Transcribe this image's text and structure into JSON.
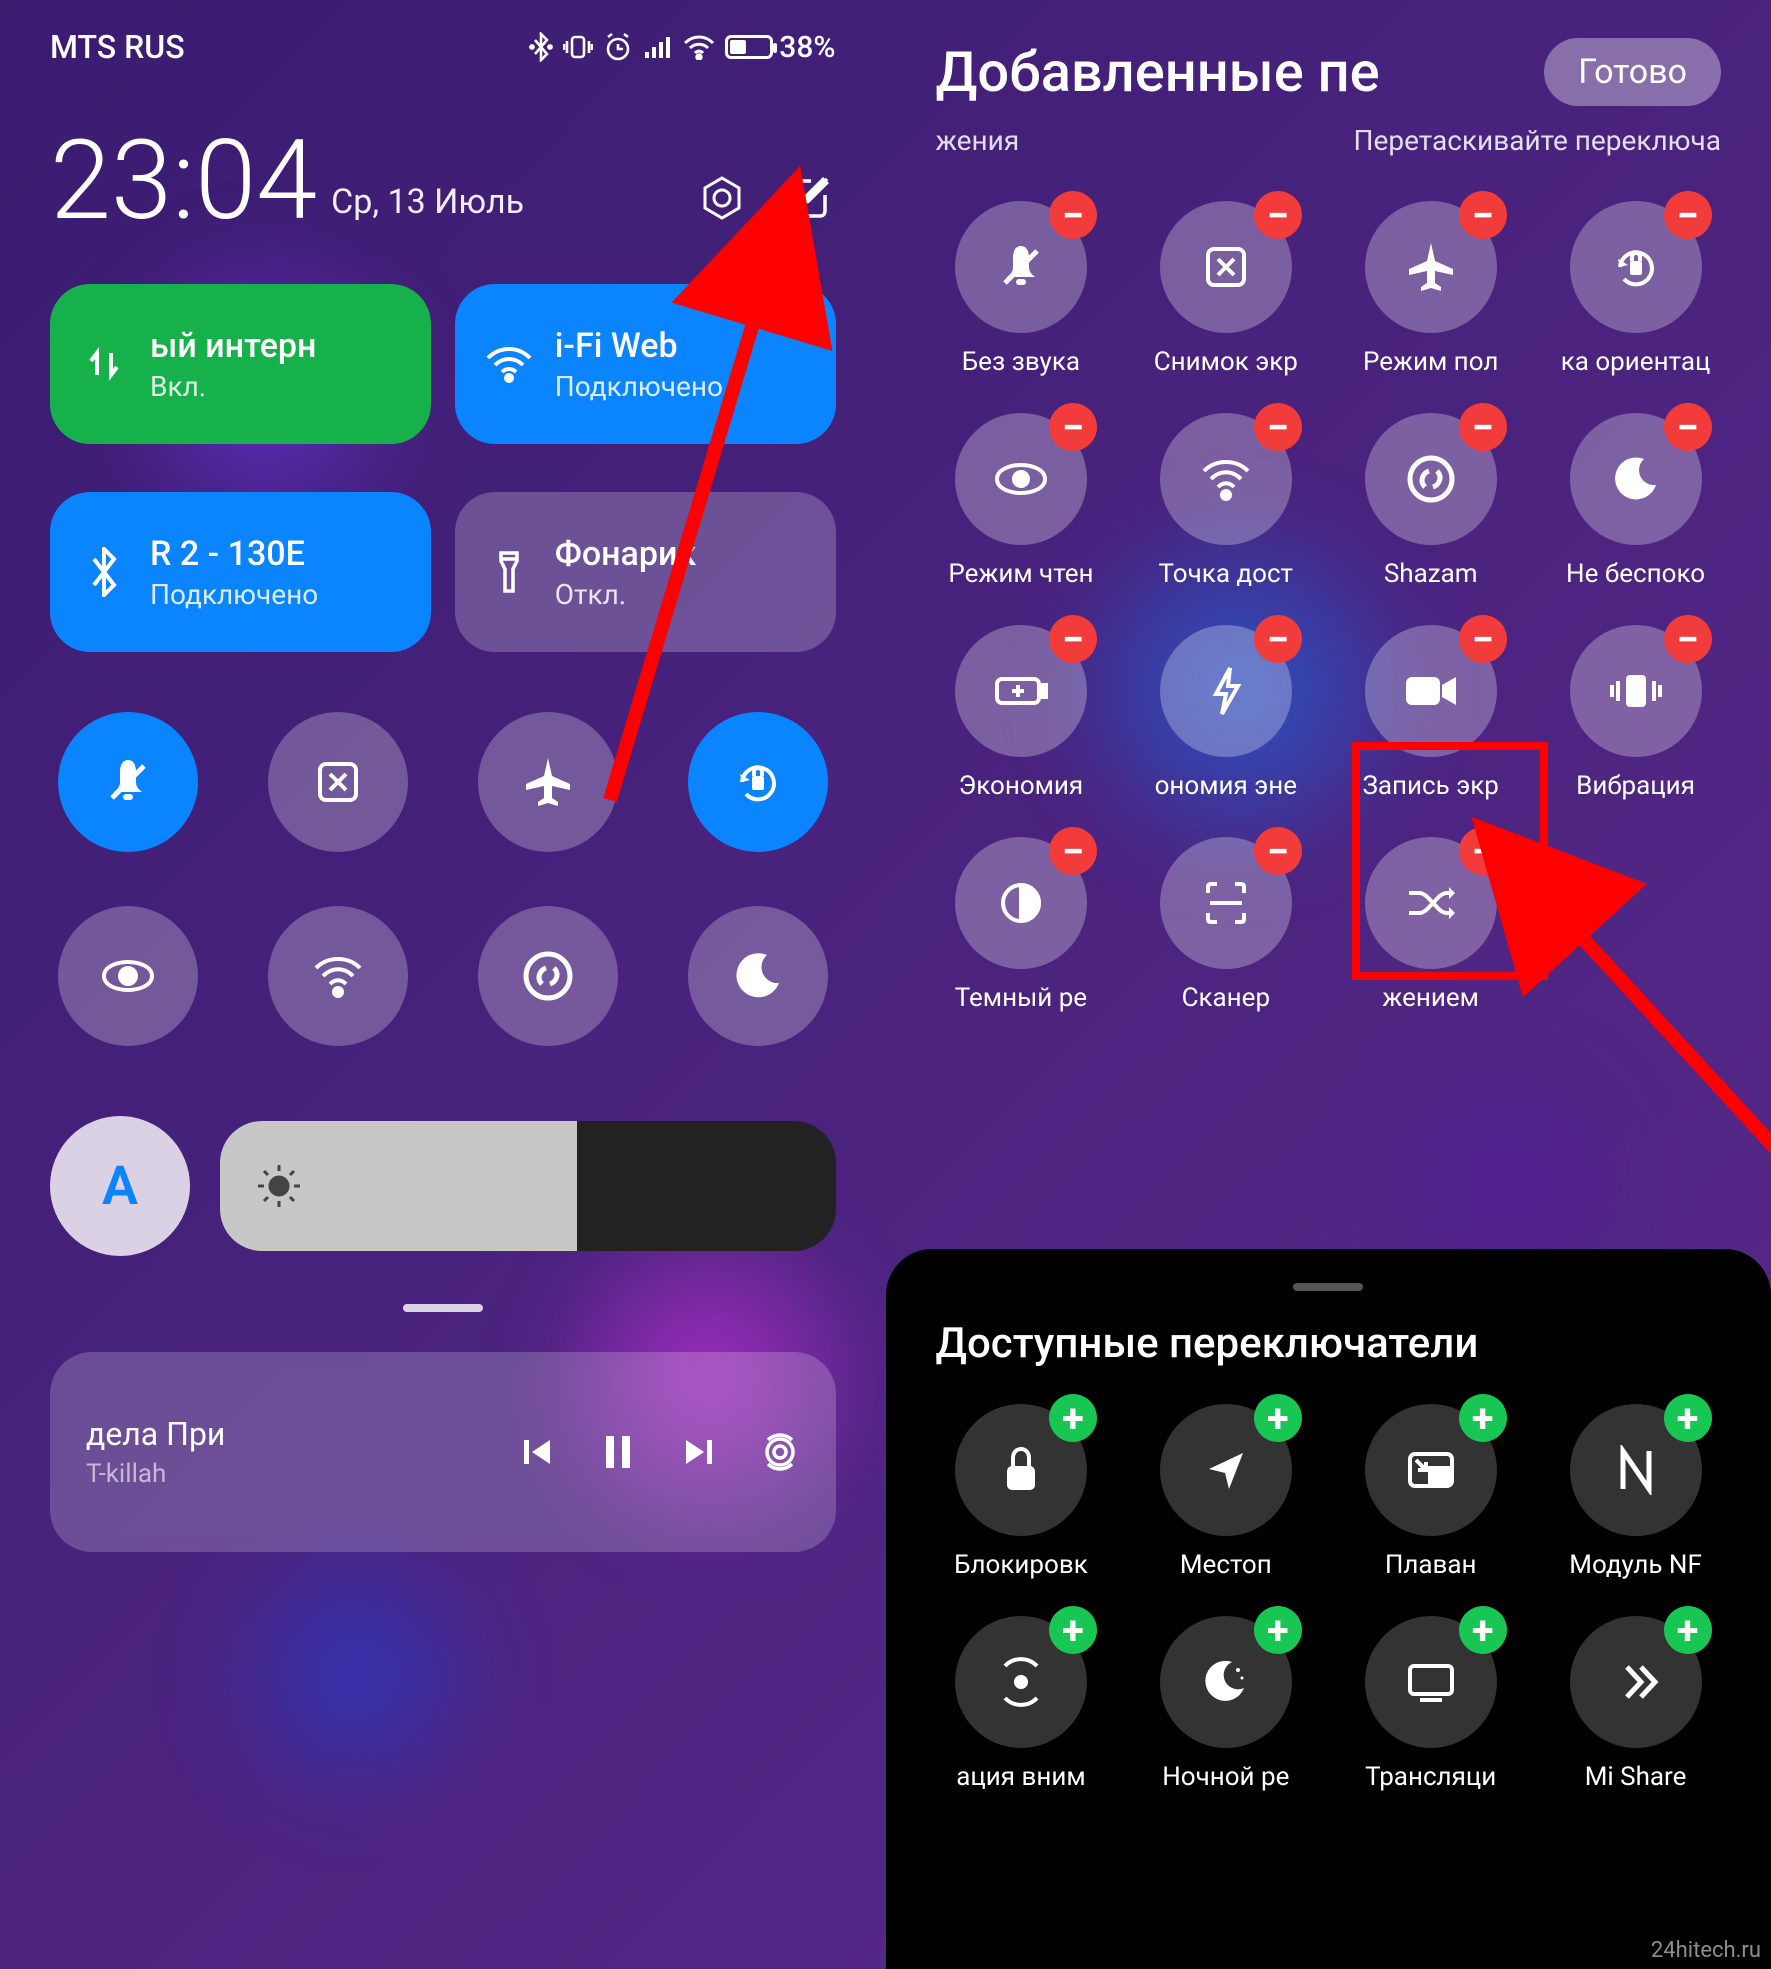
{
  "left": {
    "carrier": "MTS RUS",
    "battery_pct": "38%",
    "time": "23:04",
    "date": "Ср, 13 Июль",
    "status_icons": [
      "bluetooth",
      "vibrate",
      "alarm",
      "signal",
      "wifi",
      "battery"
    ],
    "big_tiles": [
      {
        "icon": "data",
        "title": "ый интерн",
        "sub": "Вкл.",
        "color": "green"
      },
      {
        "icon": "wifi",
        "title": "i-Fi     Web",
        "sub": "Подключено",
        "color": "blue"
      },
      {
        "icon": "bt",
        "title": "R 2 - 130E",
        "sub": "Подключено",
        "color": "blue"
      },
      {
        "icon": "flash",
        "title": "Фонарик",
        "sub": "Откл.",
        "color": "grey"
      }
    ],
    "small_toggles": [
      {
        "icon": "mute",
        "active": true
      },
      {
        "icon": "screenshot",
        "active": false
      },
      {
        "icon": "airplane",
        "active": false
      },
      {
        "icon": "rotate",
        "active": true
      },
      {
        "icon": "eye",
        "active": false
      },
      {
        "icon": "hotspot",
        "active": false
      },
      {
        "icon": "shazam",
        "active": false
      },
      {
        "icon": "moon",
        "active": false
      }
    ],
    "auto_label": "A",
    "brightness_pct": 58,
    "media": {
      "title": "дела     При",
      "artist": "T-killah"
    }
  },
  "right": {
    "header": "Добавленные пе",
    "done": "Готово",
    "sub_left": "жения",
    "sub_right": "Перетаскивайте переключа",
    "added": [
      {
        "icon": "mute",
        "label": "Без звука"
      },
      {
        "icon": "screenshot",
        "label": "Снимок экр"
      },
      {
        "icon": "airplane",
        "label": "Режим пол"
      },
      {
        "icon": "rotate",
        "label": "ка ориентац"
      },
      {
        "icon": "eye",
        "label": "Режим чтен"
      },
      {
        "icon": "hotspot",
        "label": "Точка дост"
      },
      {
        "icon": "shazam",
        "label": "Shazam"
      },
      {
        "icon": "moon",
        "label": "Не беспоко"
      },
      {
        "icon": "battery-plus",
        "label": "Экономия"
      },
      {
        "icon": "bolt",
        "label": "ономия эне"
      },
      {
        "icon": "video",
        "label": "Запись экр"
      },
      {
        "icon": "vibrate",
        "label": "Вибрация"
      },
      {
        "icon": "contrast",
        "label": "Темный ре"
      },
      {
        "icon": "scan",
        "label": "Сканер"
      },
      {
        "icon": "shuffle",
        "label": "жением"
      }
    ],
    "available_header": "Доступные переключатели",
    "available": [
      {
        "icon": "lock",
        "label": "Блокировк"
      },
      {
        "icon": "location",
        "label": "Местоп"
      },
      {
        "icon": "pip",
        "label": "Плаван"
      },
      {
        "icon": "nfc",
        "label": "Модуль NF"
      },
      {
        "icon": "focus",
        "label": "ация вним"
      },
      {
        "icon": "night",
        "label": "Ночной ре"
      },
      {
        "icon": "cast",
        "label": "Трансляци"
      },
      {
        "icon": "mishare",
        "label": "Mi Share"
      }
    ]
  },
  "watermark": "24hitech.ru"
}
